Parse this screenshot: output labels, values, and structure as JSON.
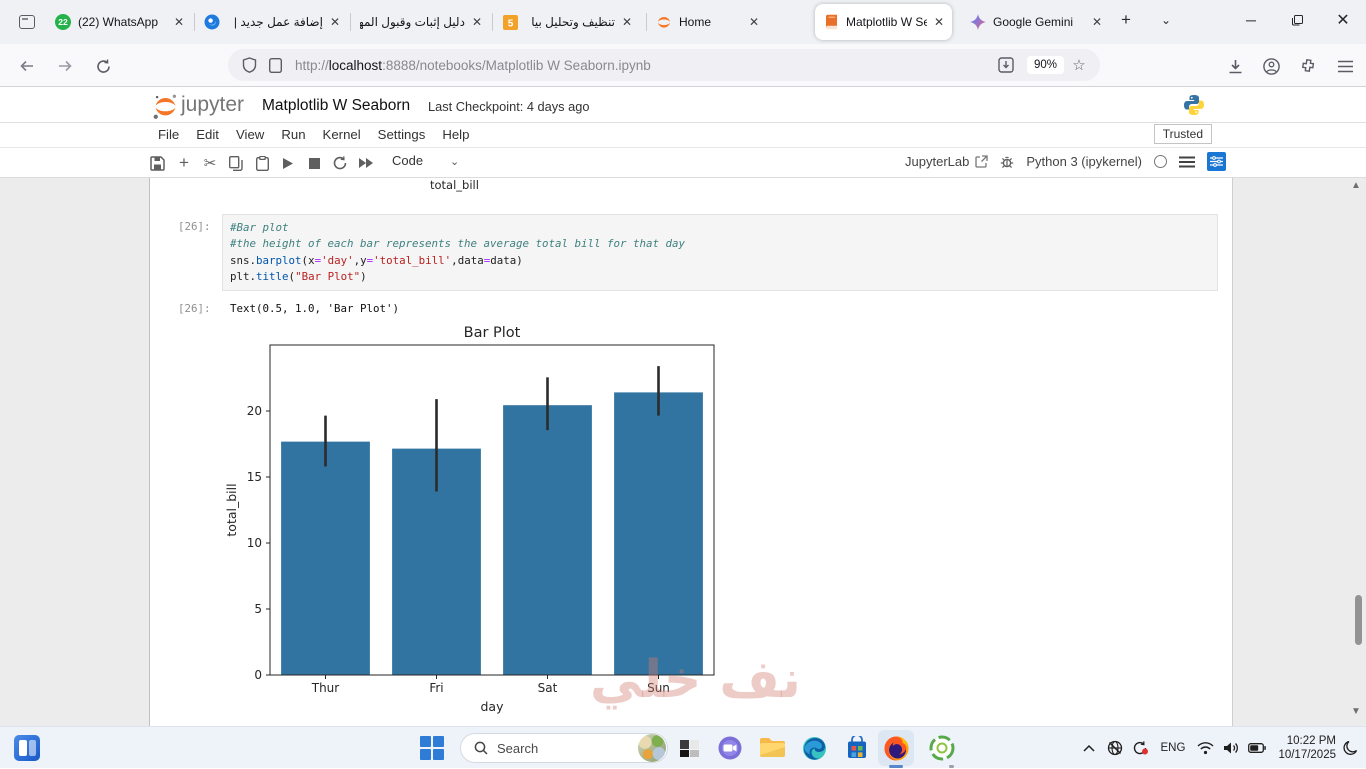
{
  "browser": {
    "tabs": [
      {
        "title": "(22) WhatsApp",
        "icon": "whatsapp",
        "badge": "22",
        "active": false
      },
      {
        "title": "إضافة عمل جديد |",
        "icon": "orb",
        "active": false
      },
      {
        "title": "دليل إثبات وقبول المها",
        "icon": "none",
        "active": false
      },
      {
        "title": "تنظيف وتحليل بيا",
        "icon": "five",
        "badge": "5",
        "active": false
      },
      {
        "title": "Home",
        "icon": "jupyter",
        "active": false
      },
      {
        "title": "Matplotlib W Sea",
        "icon": "book",
        "active": true
      },
      {
        "title": "Google Gemini",
        "icon": "gemini",
        "active": false
      }
    ],
    "url": {
      "scheme": "http://",
      "host": "localhost",
      "rest": ":8888/notebooks/Matplotlib W Seaborn.ipynb"
    },
    "zoom_level": "90%"
  },
  "jupyter": {
    "wordmark": "jupyter",
    "title": "Matplotlib W Seaborn",
    "checkpoint": "Last Checkpoint: 4 days ago",
    "menus": [
      "File",
      "Edit",
      "View",
      "Run",
      "Kernel",
      "Settings",
      "Help"
    ],
    "trusted_label": "Trusted",
    "cell_type": "Code",
    "jupyterlab_label": "JupyterLab",
    "kernel_name": "Python 3 (ipykernel)"
  },
  "notebook": {
    "prev_output_label": "total_bill",
    "cell": {
      "prompt": "[26]:",
      "code_lines": [
        [
          [
            "c",
            "#Bar plot"
          ]
        ],
        [
          [
            "c",
            "#the height of each bar represents the average total bill for that day"
          ]
        ],
        [
          [
            "v",
            "sns"
          ],
          [
            "p",
            "."
          ],
          [
            "f",
            "barplot"
          ],
          [
            "p",
            "("
          ],
          [
            "v",
            "x"
          ],
          [
            "o",
            "="
          ],
          [
            "s",
            "'day'"
          ],
          [
            "p",
            ","
          ],
          [
            "v",
            "y"
          ],
          [
            "o",
            "="
          ],
          [
            "s",
            "'total_bill'"
          ],
          [
            "p",
            ","
          ],
          [
            "v",
            "data"
          ],
          [
            "o",
            "="
          ],
          [
            "v",
            "data"
          ],
          [
            "p",
            ")"
          ]
        ],
        [
          [
            "v",
            "plt"
          ],
          [
            "p",
            "."
          ],
          [
            "f",
            "title"
          ],
          [
            "p",
            "("
          ],
          [
            "s",
            "\"Bar Plot\""
          ],
          [
            "p",
            ")"
          ]
        ]
      ],
      "output_prompt": "[26]:",
      "output_text": "Text(0.5, 1.0, 'Bar Plot')"
    },
    "watermark": "نف خلي"
  },
  "chart_data": {
    "type": "bar",
    "title": "Bar Plot",
    "xlabel": "day",
    "ylabel": "total_bill",
    "categories": [
      "Thur",
      "Fri",
      "Sat",
      "Sun"
    ],
    "values": [
      17.68,
      17.15,
      20.44,
      21.41
    ],
    "error_low": [
      15.8,
      13.9,
      18.55,
      19.65
    ],
    "error_high": [
      19.65,
      20.9,
      22.55,
      23.4
    ],
    "yticks": [
      0,
      5,
      10,
      15,
      20
    ],
    "ylim": [
      0,
      25
    ],
    "bar_color": "#3274a1",
    "error_color": "#2b2b2b",
    "grid": false,
    "legend": null
  },
  "taskbar": {
    "search_placeholder": "Search",
    "language": "ENG",
    "time": "10:22 PM",
    "date": "10/17/2025"
  }
}
